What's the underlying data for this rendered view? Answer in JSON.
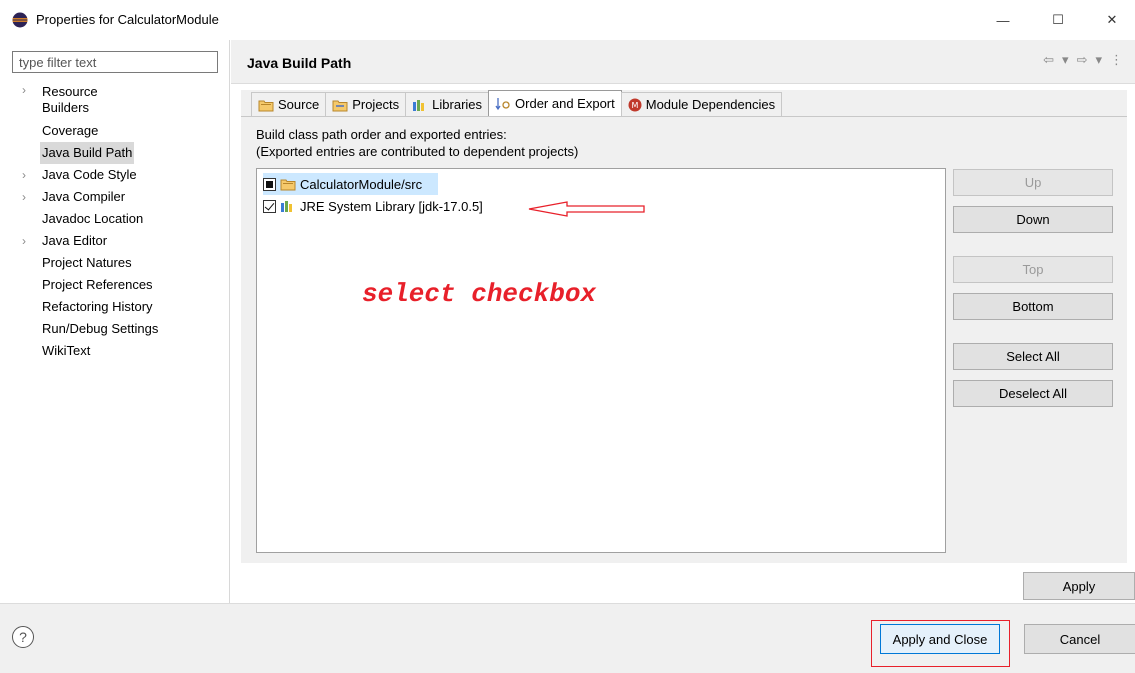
{
  "window": {
    "title": "Properties for CalculatorModule",
    "minimize_glyph": "—",
    "maximize_glyph": "☐",
    "close_glyph": "✕"
  },
  "filter": {
    "placeholder": "type filter text",
    "value": ""
  },
  "tree": {
    "items": [
      {
        "label": "Resource",
        "expandable": true
      },
      {
        "label": "Builders",
        "expandable": false
      },
      {
        "label": "Coverage",
        "expandable": false
      },
      {
        "label": "Java Build Path",
        "expandable": false,
        "selected": true
      },
      {
        "label": "Java Code Style",
        "expandable": true
      },
      {
        "label": "Java Compiler",
        "expandable": true
      },
      {
        "label": "Javadoc Location",
        "expandable": false
      },
      {
        "label": "Java Editor",
        "expandable": true
      },
      {
        "label": "Project Natures",
        "expandable": false
      },
      {
        "label": "Project References",
        "expandable": false
      },
      {
        "label": "Refactoring History",
        "expandable": false
      },
      {
        "label": "Run/Debug Settings",
        "expandable": false
      },
      {
        "label": "WikiText",
        "expandable": false
      }
    ]
  },
  "page": {
    "title": "Java Build Path",
    "tabs": [
      {
        "label": "Source",
        "icon": "source-folder-icon"
      },
      {
        "label": "Projects",
        "icon": "projects-icon"
      },
      {
        "label": "Libraries",
        "icon": "libraries-icon"
      },
      {
        "label": "Order and Export",
        "icon": "order-export-icon",
        "active": true
      },
      {
        "label": "Module Dependencies",
        "icon": "module-icon"
      }
    ],
    "description_line1": "Build class path order and exported entries:",
    "description_line2": "(Exported entries are contributed to dependent projects)",
    "entries": [
      {
        "label": "CalculatorModule/src",
        "check_state": "partial",
        "selected": true,
        "icon": "source-folder-icon"
      },
      {
        "label": "JRE System Library [jdk-17.0.5]",
        "check_state": "checked",
        "selected": false,
        "icon": "library-icon"
      }
    ],
    "annotation": "select checkbox",
    "side_buttons": [
      {
        "label": "Up",
        "enabled": false
      },
      {
        "label": "Down",
        "enabled": true
      },
      {
        "label": "Top",
        "enabled": false
      },
      {
        "label": "Bottom",
        "enabled": true
      },
      {
        "label": "Select All",
        "enabled": true
      },
      {
        "label": "Deselect All",
        "enabled": true
      }
    ],
    "apply_label": "Apply"
  },
  "footer": {
    "help_glyph": "?",
    "apply_close_label": "Apply and Close",
    "cancel_label": "Cancel"
  },
  "colors": {
    "annotation_red": "#e8202a",
    "selection_blue": "#cce8ff",
    "focus_blue": "#0078d7"
  }
}
